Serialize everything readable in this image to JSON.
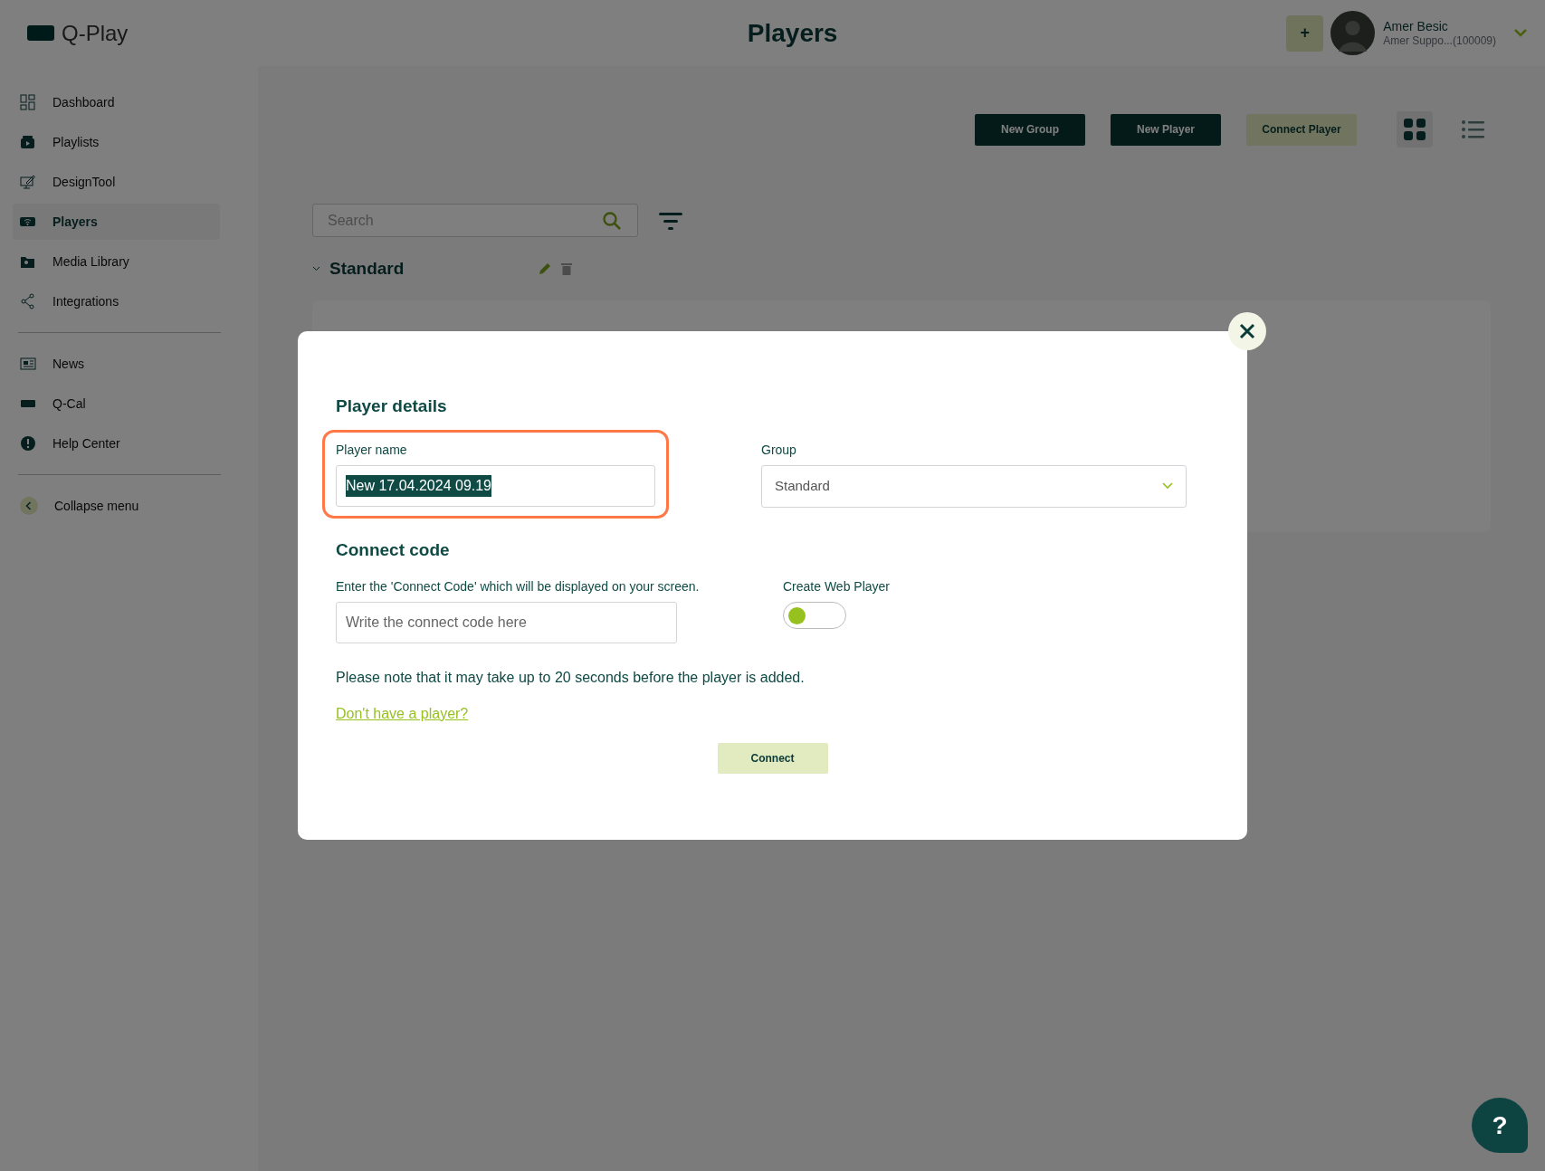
{
  "app": {
    "logo_text": "Q-Play"
  },
  "header": {
    "title": "Players",
    "add_button": "+",
    "user": {
      "name": "Amer Besic",
      "account": "Amer Suppo...(100009)"
    }
  },
  "sidebar": {
    "sections": [
      {
        "items": [
          {
            "label": "Dashboard",
            "selected": false
          },
          {
            "label": "Playlists",
            "selected": false
          },
          {
            "label": "DesignTool",
            "selected": false
          },
          {
            "label": "Players",
            "selected": true
          },
          {
            "label": "Media Library",
            "selected": false
          },
          {
            "label": "Integrations",
            "selected": false
          }
        ]
      },
      {
        "items": [
          {
            "label": "News",
            "selected": false
          },
          {
            "label": "Q-Cal",
            "selected": false
          },
          {
            "label": "Help Center",
            "selected": false
          }
        ]
      }
    ],
    "collapse": "Collapse menu"
  },
  "toolbar": {
    "buttons": [
      {
        "label": "New Group",
        "kind": "dark"
      },
      {
        "label": "New Player",
        "kind": "dark"
      },
      {
        "label": "Connect Player",
        "kind": "light"
      }
    ],
    "view_modes": [
      {
        "selected": true
      },
      {
        "selected": false
      }
    ]
  },
  "search": {
    "placeholder": "Search"
  },
  "group": {
    "name": "Standard",
    "expanded": true
  },
  "modal": {
    "details_title": "Player details",
    "player_name": {
      "label": "Player name",
      "value": "New 17.04.2024 09.19",
      "highlighted": true,
      "text_selected": true
    },
    "group_select": {
      "label": "Group",
      "value": "Standard"
    },
    "connect_title": "Connect code",
    "connect_code": {
      "label": "Enter the 'Connect Code' which will be displayed on your screen.",
      "placeholder": "Write the connect code here"
    },
    "web_player": {
      "label": "Create Web Player",
      "on": false
    },
    "note": "Please note that it may take up to 20 seconds before the player is added.",
    "link": "Don't have a player?",
    "connect_button": "Connect"
  },
  "help_button": "?"
}
